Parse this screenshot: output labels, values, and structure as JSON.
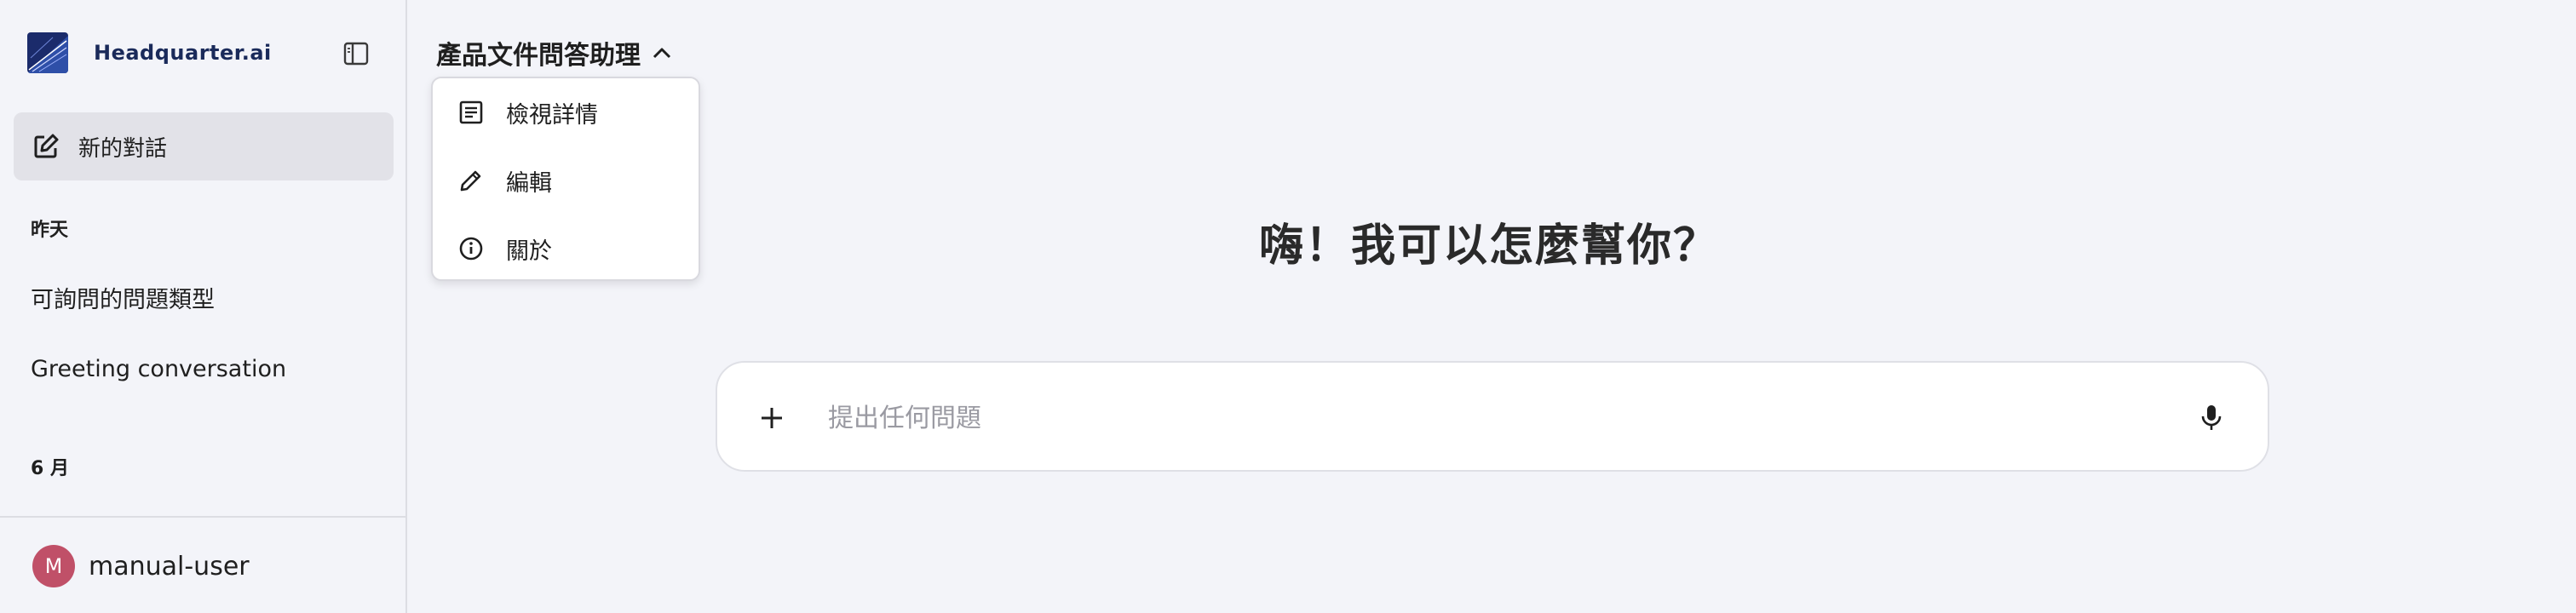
{
  "brand": {
    "name": "Headquarter.ai",
    "logo_icon": "headquarter-logo-icon",
    "toggle_icon": "sidebar-toggle-icon"
  },
  "sidebar": {
    "new_chat_label": "新的對話",
    "new_chat_icon": "edit-square-icon",
    "sections": [
      {
        "title": "昨天",
        "items": [
          {
            "label": "可詢問的問題類型"
          },
          {
            "label": "Greeting conversation"
          }
        ]
      },
      {
        "title": "6 月",
        "items": []
      }
    ],
    "user": {
      "initial": "M",
      "name": "manual-user",
      "avatar_color": "#c05068"
    }
  },
  "header": {
    "assistant_title": "產品文件問答助理",
    "chevron_icon": "chevron-up-icon"
  },
  "dropdown": {
    "items": [
      {
        "label": "檢視詳情",
        "icon": "article-icon"
      },
      {
        "label": "編輯",
        "icon": "pencil-icon"
      },
      {
        "label": "關於",
        "icon": "info-icon"
      }
    ]
  },
  "main": {
    "greeting": "嗨！我可以怎麼幫你？"
  },
  "composer": {
    "placeholder": "提出任何問題",
    "value": "",
    "add_icon": "plus-icon",
    "mic_icon": "microphone-icon"
  },
  "colors": {
    "background": "#f3f4f9",
    "selected_item": "#e2e2e8",
    "brand_text": "#1a2a5a",
    "avatar": "#c05068"
  }
}
